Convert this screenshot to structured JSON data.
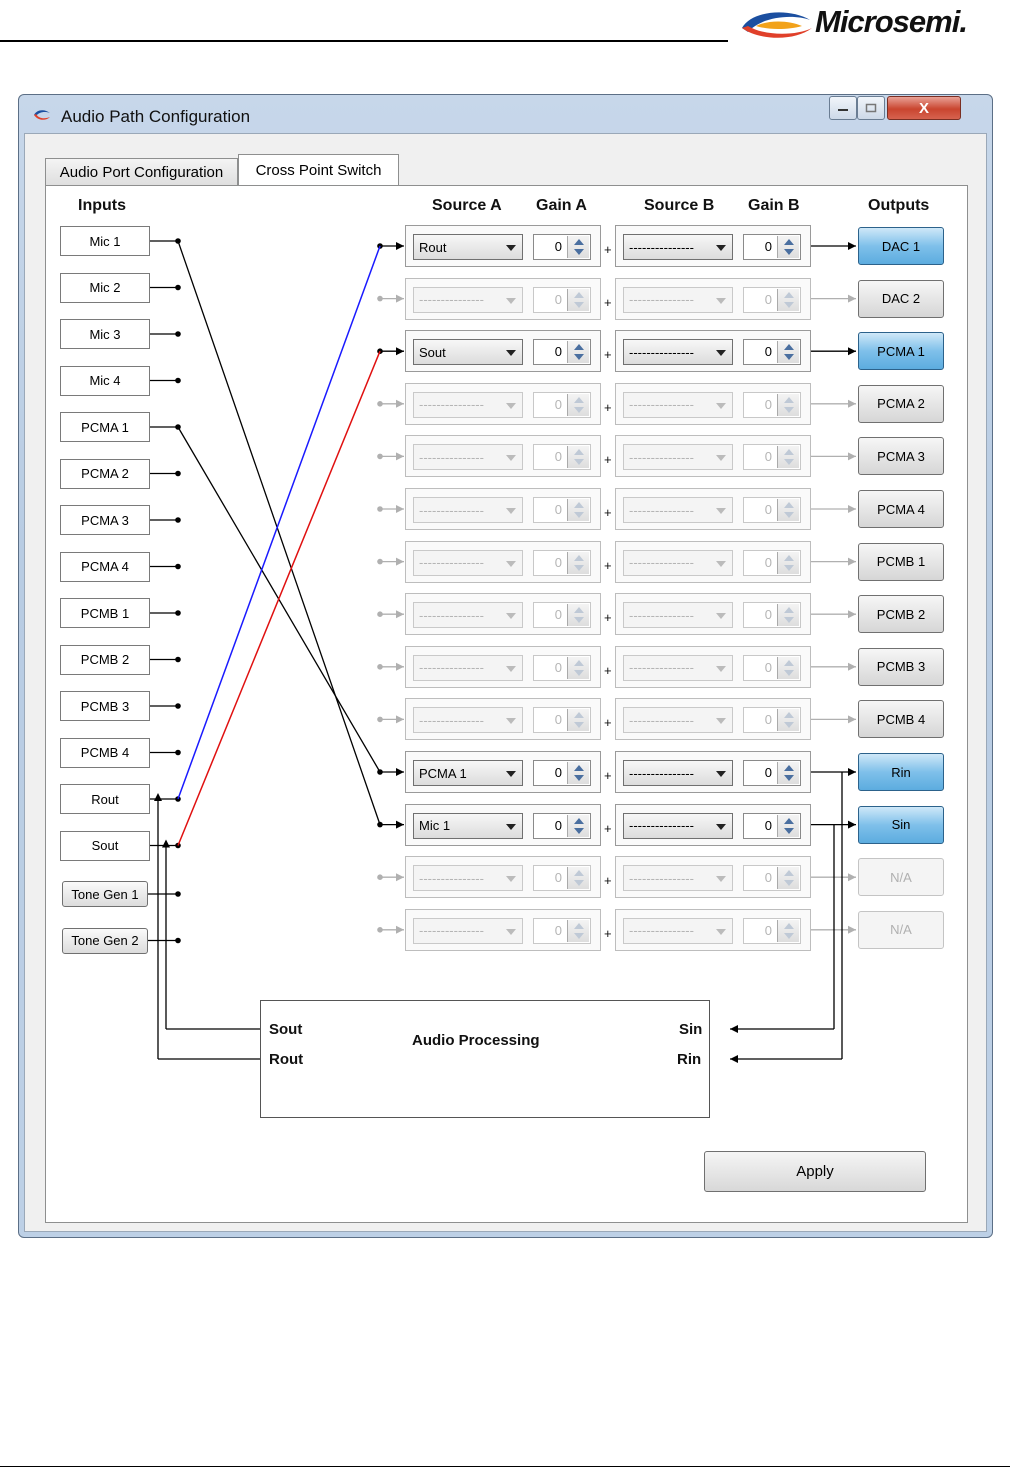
{
  "document": {
    "brand": "Microsemi."
  },
  "window": {
    "title": "Audio Path Configuration",
    "close_glyph": "X"
  },
  "tabs": [
    {
      "label": "Audio Port Configuration",
      "selected": false
    },
    {
      "label": "Cross Point Switch",
      "selected": true
    }
  ],
  "headers": {
    "inputs": "Inputs",
    "source_a": "Source A",
    "gain_a": "Gain A",
    "source_b": "Source B",
    "gain_b": "Gain B",
    "outputs": "Outputs"
  },
  "inputs": [
    {
      "label": "Mic 1"
    },
    {
      "label": "Mic 2"
    },
    {
      "label": "Mic 3"
    },
    {
      "label": "Mic 4"
    },
    {
      "label": "PCMA 1"
    },
    {
      "label": "PCMA 2"
    },
    {
      "label": "PCMA 3"
    },
    {
      "label": "PCMA 4"
    },
    {
      "label": "PCMB 1"
    },
    {
      "label": "PCMB 2"
    },
    {
      "label": "PCMB 3"
    },
    {
      "label": "PCMB 4"
    },
    {
      "label": "Rout"
    },
    {
      "label": "Sout"
    },
    {
      "label": "Tone Gen 1"
    },
    {
      "label": "Tone Gen 2"
    }
  ],
  "routes": [
    {
      "source_a": "Rout",
      "gain_a": "0",
      "source_b": "---------------",
      "gain_b": "0",
      "plus": "+",
      "output": "DAC 1",
      "active": true
    },
    {
      "source_a": "---------------",
      "gain_a": "0",
      "source_b": "---------------",
      "gain_b": "0",
      "plus": "+",
      "output": "DAC 2",
      "active": false
    },
    {
      "source_a": "Sout",
      "gain_a": "0",
      "source_b": "---------------",
      "gain_b": "0",
      "plus": "+",
      "output": "PCMA 1",
      "active": true
    },
    {
      "source_a": "---------------",
      "gain_a": "0",
      "source_b": "---------------",
      "gain_b": "0",
      "plus": "+",
      "output": "PCMA 2",
      "active": false
    },
    {
      "source_a": "---------------",
      "gain_a": "0",
      "source_b": "---------------",
      "gain_b": "0",
      "plus": "+",
      "output": "PCMA 3",
      "active": false
    },
    {
      "source_a": "---------------",
      "gain_a": "0",
      "source_b": "---------------",
      "gain_b": "0",
      "plus": "+",
      "output": "PCMA 4",
      "active": false
    },
    {
      "source_a": "---------------",
      "gain_a": "0",
      "source_b": "---------------",
      "gain_b": "0",
      "plus": "+",
      "output": "PCMB 1",
      "active": false
    },
    {
      "source_a": "---------------",
      "gain_a": "0",
      "source_b": "---------------",
      "gain_b": "0",
      "plus": "+",
      "output": "PCMB 2",
      "active": false
    },
    {
      "source_a": "---------------",
      "gain_a": "0",
      "source_b": "---------------",
      "gain_b": "0",
      "plus": "+",
      "output": "PCMB 3",
      "active": false
    },
    {
      "source_a": "---------------",
      "gain_a": "0",
      "source_b": "---------------",
      "gain_b": "0",
      "plus": "+",
      "output": "PCMB 4",
      "active": false
    },
    {
      "source_a": "PCMA 1",
      "gain_a": "0",
      "source_b": "---------------",
      "gain_b": "0",
      "plus": "+",
      "output": "Rin",
      "active": true
    },
    {
      "source_a": "Mic 1",
      "gain_a": "0",
      "source_b": "---------------",
      "gain_b": "0",
      "plus": "+",
      "output": "Sin",
      "active": true
    },
    {
      "source_a": "---------------",
      "gain_a": "0",
      "source_b": "---------------",
      "gain_b": "0",
      "plus": "+",
      "output": "N/A",
      "active": false,
      "disabled": true
    },
    {
      "source_a": "---------------",
      "gain_a": "0",
      "source_b": "---------------",
      "gain_b": "0",
      "plus": "+",
      "output": "N/A",
      "active": false,
      "disabled": true
    }
  ],
  "processing": {
    "title": "Audio Processing",
    "sout": "Sout",
    "rout": "Rout",
    "sin": "Sin",
    "rin": "Rin"
  },
  "apply_label": "Apply",
  "colors": {
    "active_output": "#5cacdf",
    "wire_black": "#000000",
    "wire_blue": "#1a1aff",
    "wire_red": "#e01010",
    "disabled": "#b0b0b0"
  }
}
